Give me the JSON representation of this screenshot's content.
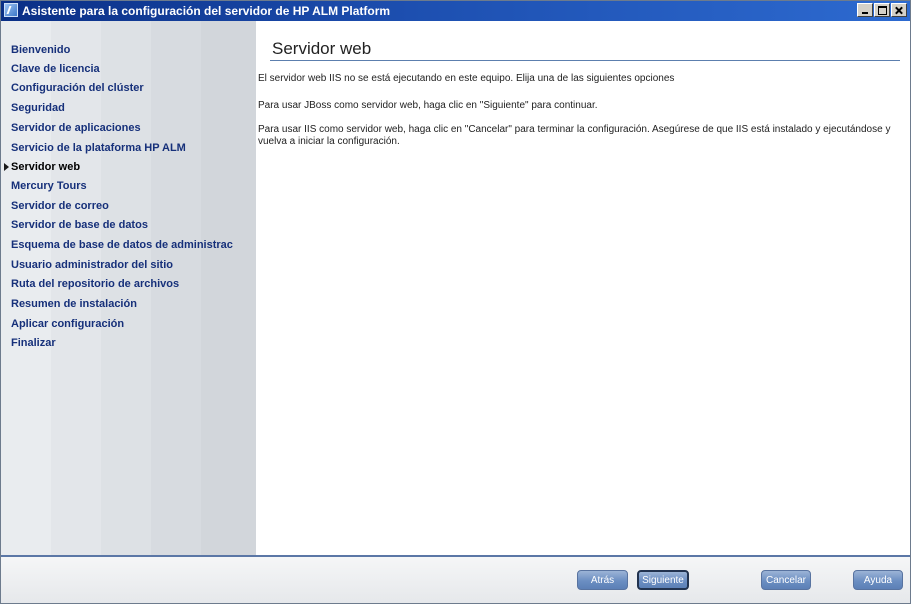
{
  "window": {
    "title": "Asistente para la configuración del servidor de HP ALM Platform"
  },
  "sidebar": {
    "items": [
      {
        "label": "Bienvenido"
      },
      {
        "label": "Clave de licencia"
      },
      {
        "label": "Configuración del clúster"
      },
      {
        "label": "Seguridad"
      },
      {
        "label": "Servidor de aplicaciones"
      },
      {
        "label": "Servicio de la plataforma HP ALM"
      },
      {
        "label": "Servidor web",
        "active": true
      },
      {
        "label": "Mercury Tours"
      },
      {
        "label": "Servidor de correo"
      },
      {
        "label": "Servidor de base de datos"
      },
      {
        "label": "Esquema de base de datos de administrac"
      },
      {
        "label": "Usuario administrador del sitio"
      },
      {
        "label": "Ruta del repositorio de archivos"
      },
      {
        "label": "Resumen de instalación"
      },
      {
        "label": "Aplicar configuración"
      },
      {
        "label": "Finalizar"
      }
    ]
  },
  "content": {
    "title": "Servidor web",
    "paragraphs": [
      "El servidor web IIS no se está ejecutando en este equipo. Elija una de las siguientes opciones",
      "Para usar JBoss como servidor web, haga clic en \"Siguiente\" para continuar.",
      "Para usar IIS como servidor web, haga clic en \"Cancelar\" para terminar la configuración. Asegúrese de que IIS está instalado y ejecutándose y vuelva a iniciar la configuración."
    ]
  },
  "footer": {
    "back": "Atrás",
    "next": "Siguiente",
    "cancel": "Cancelar",
    "help": "Ayuda"
  }
}
